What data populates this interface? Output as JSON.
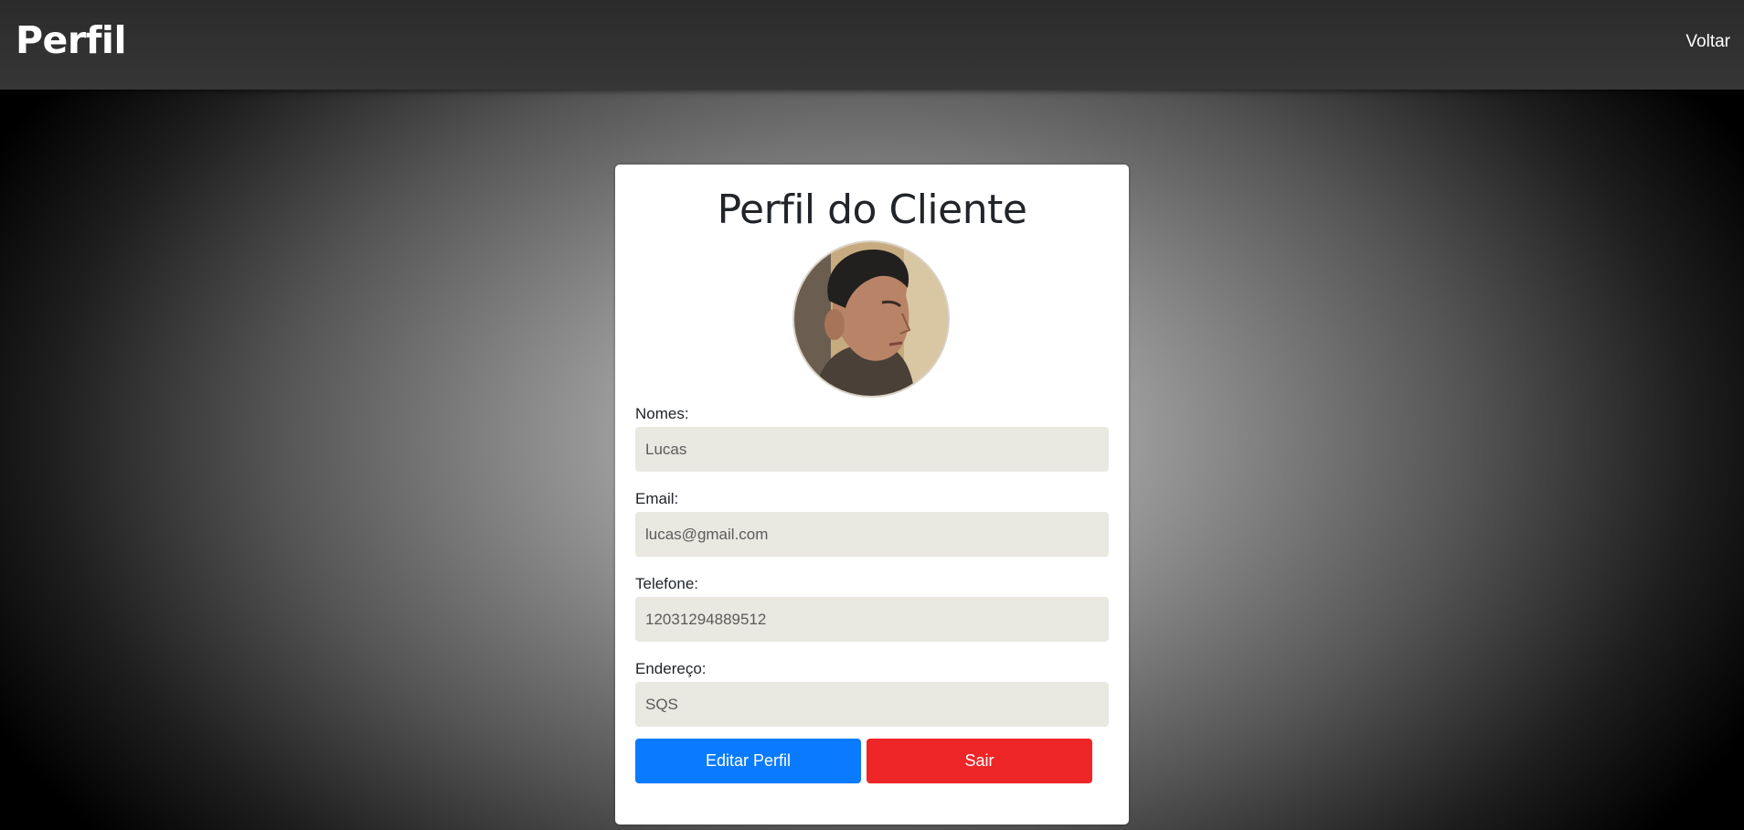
{
  "header": {
    "title": "Perfil",
    "back_label": "Voltar"
  },
  "card": {
    "title": "Perfil do Cliente",
    "avatar_icon": "profile-photo",
    "fields": [
      {
        "label": "Nomes:",
        "value": "Lucas"
      },
      {
        "label": "Email:",
        "value": "lucas@gmail.com"
      },
      {
        "label": "Telefone:",
        "value": "12031294889512"
      },
      {
        "label": "Endereço:",
        "value": "SQS"
      }
    ],
    "edit_button": "Editar Perfil",
    "exit_button": "Sair"
  },
  "colors": {
    "topbar": "#333333",
    "edit_button": "#0a7bff",
    "exit_button": "#ee2628",
    "input_background": "#e9e8e1"
  }
}
